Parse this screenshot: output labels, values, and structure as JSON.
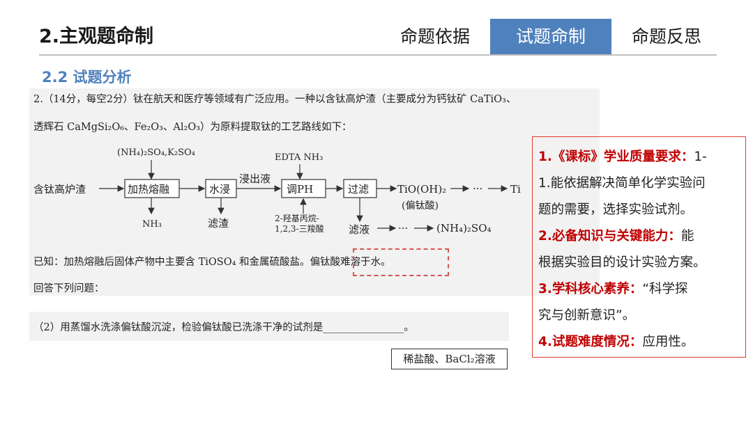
{
  "header": {
    "title": "2.主观题命制",
    "tabs": [
      {
        "label": "命题依据",
        "active": false
      },
      {
        "label": "试题命制",
        "active": true
      },
      {
        "label": "命题反思",
        "active": false
      }
    ]
  },
  "section_title": "2.2 试题分析",
  "question": {
    "line1": "2.（14分，每空2分）钛在航天和医疗等领域有广泛应用。一种以含钛高炉渣（主要成分为钙钛矿 CaTiO₃、",
    "line2": "透辉石 CaMgSi₂O₆、Fe₂O₃、Al₂O₃）为原料提取钛的工艺路线如下：",
    "flow": {
      "start": "含钛高炉渣",
      "reagent1": "(NH₄)₂SO₄,K₂SO₄",
      "step1": "加热熔融",
      "byproduct1": "NH₃",
      "step2": "水浸",
      "residue": "滤渣",
      "liquid_label": "浸出液",
      "reagent2": "EDTA NH₃",
      "step3": "调PH",
      "reagent3_line1": "2-羟基丙烷-",
      "reagent3_line2": "1,2,3-三羧酸",
      "step4": "过滤",
      "product": "TiO(OH)₂",
      "product_name": "(偏钛酸)",
      "ellipsis": "···",
      "final": "Ti",
      "filtrate": "滤液",
      "filtrate_product": "(NH₄)₂SO₄"
    },
    "known_prefix": "已知：加热熔融后固体产物中主要含 TiOSO₄ 和金属硫酸盐。",
    "known_highlight": "偏钛酸难溶于水。",
    "answer_prompt": "回答下列问题：",
    "sub_question": "（2）用蒸馏水洗涤偏钛酸沉淀，检验偏钛酸已洗涤干净的试剂是________________。",
    "answer": "稀盐酸、BaCl₂溶液"
  },
  "requirements": [
    {
      "key": "1.《课标》学业质量要求：",
      "text": "1-"
    },
    {
      "key": "",
      "text": "1.能依据解决简单化学实验问"
    },
    {
      "key": "",
      "text": "题的需要，选择实验试剂。"
    },
    {
      "key": "2.必备知识与关键能力：",
      "text": "能"
    },
    {
      "key": "",
      "text": "根据实验目的设计实验方案。"
    },
    {
      "key": "3.学科核心素养：",
      "text": "“科学探"
    },
    {
      "key": "",
      "text": "究与创新意识”。"
    },
    {
      "key": "4.试题难度情况：",
      "text": "应用性。"
    }
  ],
  "colors": {
    "accent_blue": "#4f81bd",
    "highlight_red": "#c00000",
    "box_red": "#e03c31"
  }
}
